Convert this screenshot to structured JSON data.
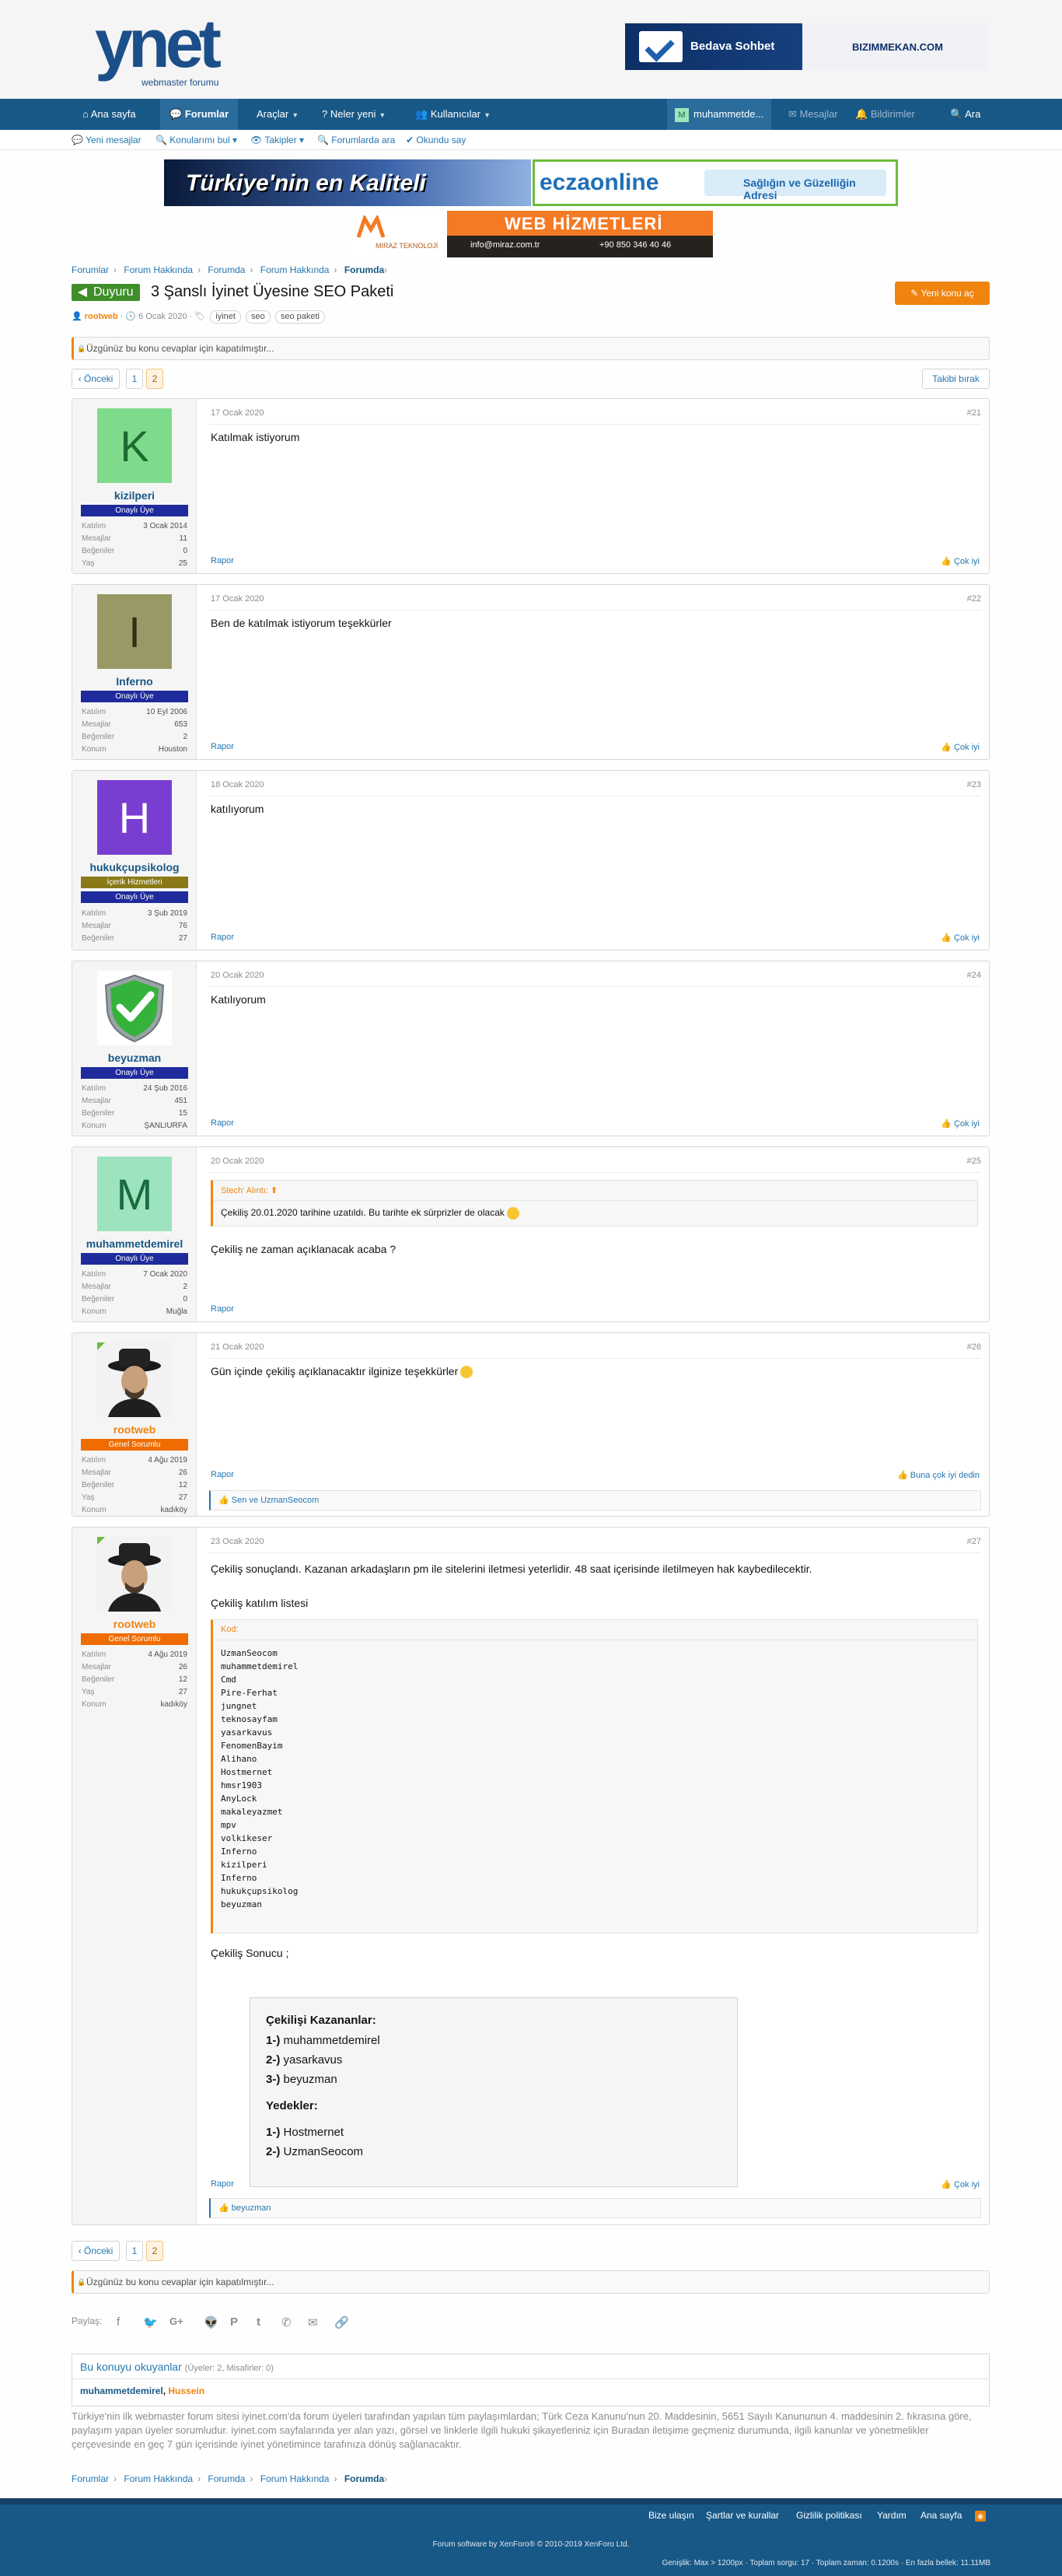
{
  "header": {
    "logo_text": "ynet",
    "logo_sub": "webmaster forumu",
    "banner_left": "Bedava Sohbet",
    "banner_right": "BIZIMMEKAN.COM"
  },
  "nav": {
    "items": [
      "Ana sayfa",
      "Forumlar",
      "Araçlar",
      "Neler yeni",
      "Kullanıcılar"
    ],
    "user": "muhammetde...",
    "messages": "Mesajlar",
    "alerts": "Bildirimler",
    "search": "Ara"
  },
  "subnav": [
    "Yeni mesajlar",
    "Konularımı bul",
    "Takipler",
    "Forumlarda ara",
    "Okundu say"
  ],
  "ads": {
    "ad1_left": "Türkiye'nin en Kaliteli",
    "ad1_brand": "eczaonline",
    "ad1_slogan": "Sağlığın ve Güzelliğin Adresi",
    "ad2_title": "WEB HİZMETLERİ",
    "ad2_brand": "MIRAZ TEKNOLOJİ",
    "ad2_email": "info@miraz.com.tr",
    "ad2_phone": "+90 850 346 40 46"
  },
  "breadcrumb": [
    "Forumlar",
    "Forum Hakkında",
    "Forumda",
    "Forum Hakkında",
    "Forumda"
  ],
  "thread": {
    "prefix": "Duyuru",
    "title": "3 Şanslı İyinet Üyesine SEO Paketi",
    "author": "rootweb",
    "date": "6 Ocak 2020",
    "tags": [
      "iyinet",
      "seo",
      "seo paketi"
    ],
    "new_thread": "Yeni konu aç",
    "locked": "Üzgünüz bu konu cevaplar için kapatılmıştır...",
    "watch": "Takibi bırak"
  },
  "pager": {
    "prev": "Önceki",
    "pages": [
      "1",
      "2"
    ]
  },
  "labels": {
    "report": "Rapor",
    "like": "Çok iyi",
    "like_rootweb": "Buna çok iyi dedin",
    "joined": "Katılım",
    "messages": "Mesajlar",
    "likes": "Beğeniler",
    "age": "Yaş",
    "location": "Konum"
  },
  "posts": [
    {
      "date": "17 Ocak 2020",
      "num": "#21",
      "user": "kizilperi",
      "initial": "K",
      "color": "#7fdb8c",
      "title": "Onaylı Üye",
      "joined": "3 Ocak 2014",
      "messages": "11",
      "likes": "0",
      "extra_k": "Yaş",
      "extra_v": "25",
      "text": "Katılmak istiyorum"
    },
    {
      "date": "17 Ocak 2020",
      "num": "#22",
      "user": "Inferno",
      "initial": "I",
      "color": "#999966",
      "title": "Onaylı Üye",
      "joined": "10 Eyl 2006",
      "messages": "653",
      "likes": "2",
      "extra_k": "Konum",
      "extra_v": "Houston",
      "text": "Ben de katılmak istiyorum teşekkürler"
    },
    {
      "date": "18 Ocak 2020",
      "num": "#23",
      "user": "hukukçupsikolog",
      "initial": "H",
      "color": "#7a3dd1",
      "title": "Onaylı Üye",
      "title2": "İçerik Hizmetleri",
      "joined": "3 Şub 2019",
      "messages": "76",
      "likes": "27",
      "text": "katılıyorum"
    },
    {
      "date": "20 Ocak 2020",
      "num": "#24",
      "user": "beyuzman",
      "title": "Onaylı Üye",
      "joined": "24 Şub 2016",
      "messages": "451",
      "likes": "15",
      "extra_k": "Konum",
      "extra_v": "ŞANLIURFA",
      "text": "Katılıyorum"
    },
    {
      "date": "20 Ocak 2020",
      "num": "#25",
      "user": "muhammetdemirel",
      "initial": "M",
      "color": "#9de3bd",
      "title": "Onaylı Üye",
      "joined": "7 Ocak 2020",
      "messages": "2",
      "likes": "0",
      "extra_k": "Konum",
      "extra_v": "Muğla",
      "quote_head": "Stech' Alıntı:",
      "quote_body": "Çekiliş 20.01.2020 tarihine uzatıldı. Bu tarihte ek sürprizler de olacak",
      "text": "Çekiliş ne zaman açıklanacak acaba ?"
    },
    {
      "date": "21 Ocak 2020",
      "num": "#26",
      "user": "rootweb",
      "title": "Genel Sorumlu",
      "joined": "4 Ağu 2019",
      "messages": "26",
      "likes": "12",
      "age": "27",
      "location": "kadıköy",
      "text": "Gün içinde çekiliş açıklanacaktır ilginize teşekkürler",
      "likes_by": "Sen ve UzmanSeocom"
    },
    {
      "date": "23 Ocak 2020",
      "num": "#27",
      "user": "rootweb",
      "title": "Genel Sorumlu",
      "joined": "4 Ağu 2019",
      "messages": "26",
      "likes": "12",
      "age": "27",
      "location": "kadıköy",
      "text": "Çekiliş sonuçlandı. Kazanan arkadaşların pm ile sitelerini iletmesi yeterlidir. 48 saat içerisinde iletilmeyen hak kaybedilecektir.",
      "list_title": "Çekiliş katılım listesi",
      "code_head": "Kod:",
      "code": "UzmanSeocom\nmuhammetdemirel\nCmd\nPire-Ferhat\njungnet\nteknosayfam\nyasarkavus\nFenomenBayim\nAlihano\nHostmernet\nhmsr1903\nAnyLock\nmakaleyazmet\nmpv\nvolkikeser\nInferno\nkizilperi\nInferno\nhukukçupsikolog\nbeyuzman",
      "result_title": "Çekiliş Sonucu ;",
      "winners_head": "Çekilişi Kazananlar:",
      "winners": [
        "muhammetdemirel",
        "yasarkavus",
        "beyuzman"
      ],
      "reserves_head": "Yedekler:",
      "reserves": [
        "Hostmernet",
        "UzmanSeocom"
      ],
      "likes_by": "beyuzman"
    }
  ],
  "share_label": "Paylaş:",
  "readers": {
    "title": "Bu konuyu okuyanlar",
    "count": "(Üyeler: 2, Misafirler: 0)",
    "names": [
      "muhammetdemirel",
      "Hussein"
    ]
  },
  "footer": {
    "disclaimer": "Türkiye'nin ilk webmaster forum sitesi iyinet.com'da forum üyeleri tarafından yapılan tüm paylaşımlardan; Türk Ceza Kanunu'nun 20. Maddesinin, 5651 Sayılı Kanununun 4. maddesinin 2. fıkrasına göre, paylaşım yapan üyeler sorumludur. iyinet.com sayfalarında yer alan yazı, görsel ve linklerle ilgili hukuki şikayetleriniz için Buradan iletişime geçmeniz durumunda, ilgili kanunlar ve yönetmelikler çerçevesinde en geç 7 gün içerisinde iyinet yönetimince tarafınıza dönüş sağlanacaktır.",
    "links": [
      "Bize ulaşın",
      "Şartlar ve kurallar",
      "Gizlilik politikası",
      "Yardım",
      "Ana sayfa"
    ],
    "copyright": "Forum software by XenForo® © 2010-2019 XenForo Ltd.",
    "stats": "Genişlik: Max > 1200px · Toplam sorgu: 17 · Toplam zaman: 0.1200s · En fazla bellek: 11.11MB"
  },
  "colors": {
    "nav": "#185886",
    "accent": "#f0840e",
    "link": "#2577b1"
  }
}
